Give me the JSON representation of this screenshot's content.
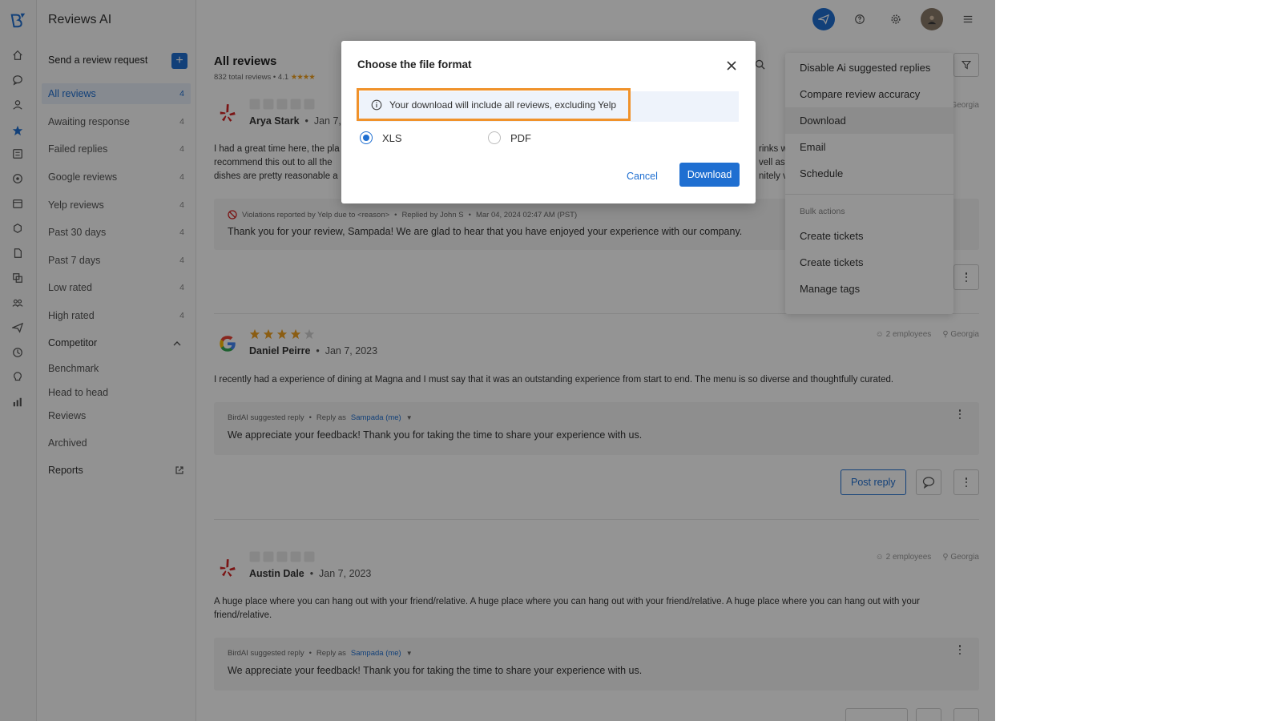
{
  "app": {
    "title": "Reviews AI"
  },
  "nav": {
    "send_request": "Send a review request",
    "items": [
      {
        "label": "All reviews",
        "count": "4"
      },
      {
        "label": "Awaiting response",
        "count": "4"
      },
      {
        "label": "Failed replies",
        "count": "4"
      },
      {
        "label": "Google reviews",
        "count": "4"
      },
      {
        "label": "Yelp reviews",
        "count": "4"
      },
      {
        "label": "Past 30 days",
        "count": "4"
      },
      {
        "label": "Past 7 days",
        "count": "4"
      },
      {
        "label": "Low rated",
        "count": "4"
      },
      {
        "label": "High rated",
        "count": "4"
      }
    ],
    "competitor": "Competitor",
    "competitor_items": [
      "Benchmark",
      "Head to head",
      "Reviews"
    ],
    "archived": "Archived",
    "reports": "Reports"
  },
  "main": {
    "title": "All reviews",
    "subtitle": "832 total reviews • 4.1",
    "rating_stars": "★★★★"
  },
  "reviews": [
    {
      "source": "yelp",
      "name": "Arya Stark",
      "date": "Jan 7,",
      "location": "Georgia",
      "text_lines": [
        "I had a great time here, the pla",
        "recommend this out to all the",
        "dishes are pretty reasonable a"
      ],
      "text_right_lines": [
        "rinks w",
        "vell as",
        "nitely v"
      ],
      "reply_meta": "Violations reported by Yelp due to <reason>",
      "reply_by": "Replied by John S",
      "reply_time": "Mar 04, 2024 02:47 AM (PST)",
      "reply_text": "Thank you for your review, Sampada! We are glad to hear that you have enjoyed your experience with our company."
    },
    {
      "source": "google",
      "name": "Daniel Peirre",
      "date": "Jan 7, 2023",
      "employees": "2 employees",
      "location": "Georgia",
      "rating": 4,
      "text": "I recently had a experience of dining at Magna and I must say that it was an outstanding experience from start to end. The menu is so diverse and thoughtfully curated.",
      "reply_label": "BirdAI suggested reply",
      "reply_as": "Reply as",
      "reply_user": "Sampada (me)",
      "reply_text": "We appreciate your feedback! Thank you for taking the time to share your experience with us.",
      "post_reply": "Post reply"
    },
    {
      "source": "yelp",
      "name": "Austin Dale",
      "date": "Jan 7, 2023",
      "employees": "2 employees",
      "location": "Georgia",
      "text": "A huge place where you can hang out with your friend/relative. A huge place where you can hang out with your friend/relative. A huge place where you can hang out with your friend/relative.",
      "reply_label": "BirdAI suggested reply",
      "reply_as": "Reply as",
      "reply_user": "Sampada (me)",
      "reply_text": "We appreciate your feedback! Thank you for taking the time to share your experience with us."
    }
  ],
  "menu": {
    "items": [
      "Disable Ai suggested replies",
      "Compare review accuracy",
      "Download",
      "Email",
      "Schedule"
    ],
    "bulk_header": "Bulk actions",
    "bulk_items": [
      "Create tickets",
      "Create tickets",
      "Manage tags"
    ]
  },
  "modal": {
    "title": "Choose the file format",
    "info": "Your download will include all reviews, excluding Yelp",
    "options": [
      {
        "label": "XLS",
        "selected": true
      },
      {
        "label": "PDF",
        "selected": false
      }
    ],
    "cancel": "Cancel",
    "download": "Download"
  },
  "colors": {
    "primary": "#1f6fd1",
    "highlight": "#f0922b",
    "star": "#f0a020",
    "yelp": "#d32323"
  }
}
